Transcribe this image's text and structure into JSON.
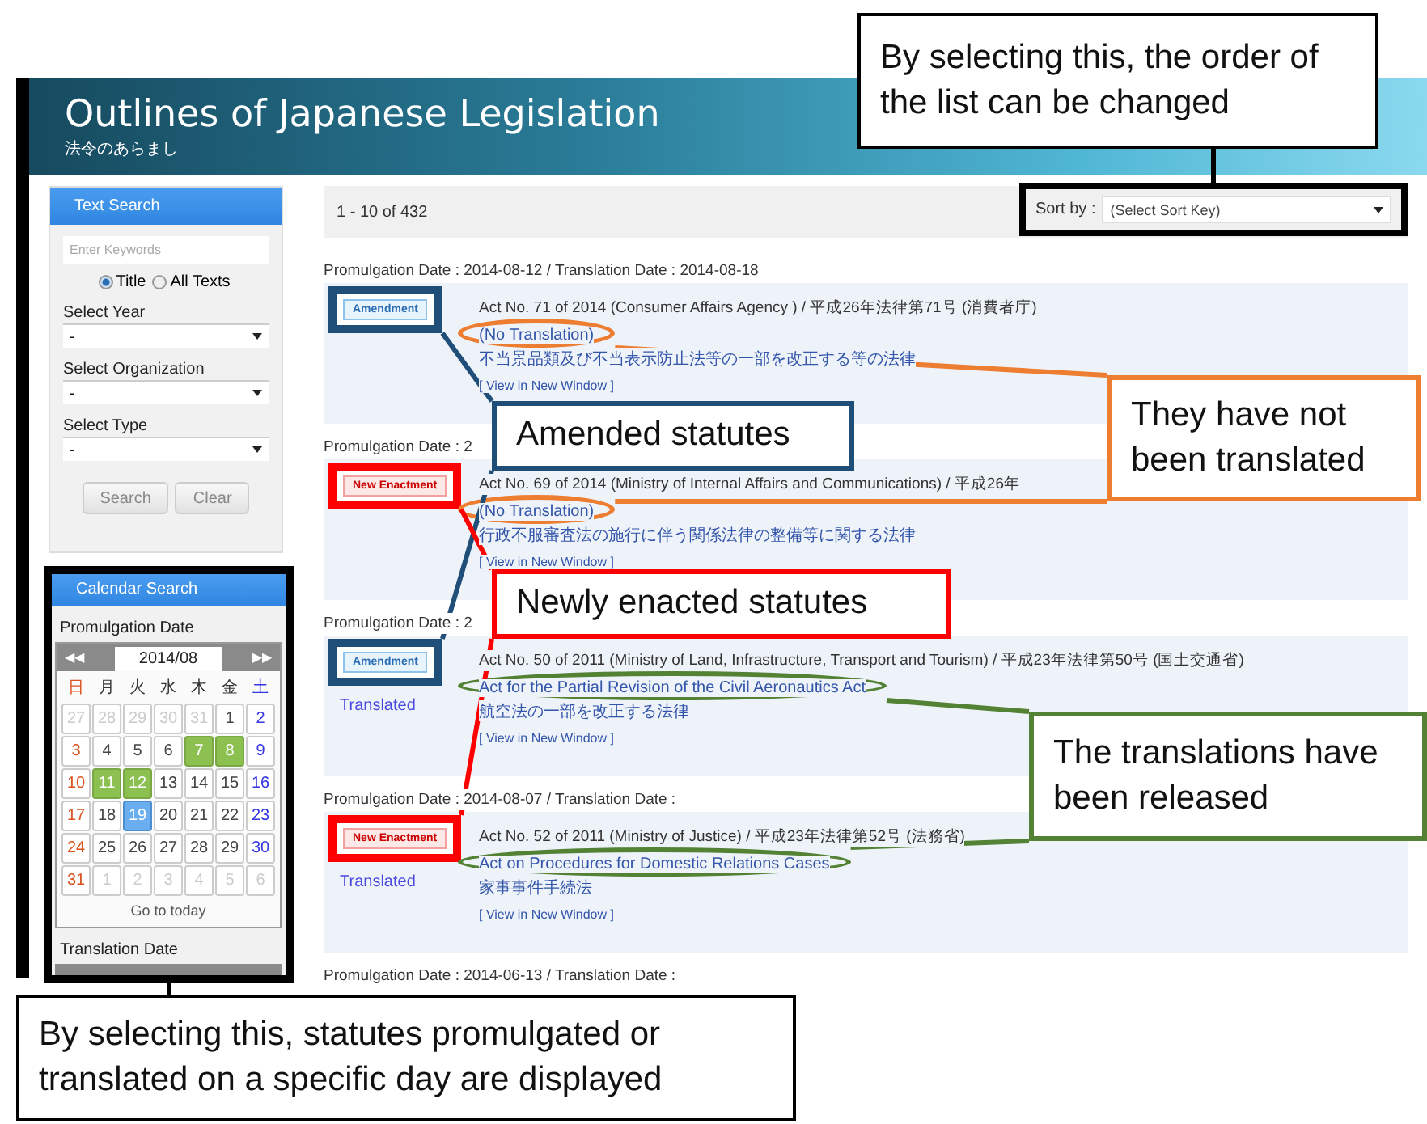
{
  "header": {
    "title": "Outlines of Japanese Legislation",
    "subtitle": "法令のあらまし"
  },
  "text_search": {
    "title": "Text Search",
    "keywords": {
      "placeholder": "Enter Keywords"
    },
    "scope": [
      {
        "label": "Title",
        "selected": true
      },
      {
        "label": "All Texts",
        "selected": false
      }
    ],
    "filters": [
      {
        "label": "Select Year",
        "value": "-"
      },
      {
        "label": "Select Organization",
        "value": "-"
      },
      {
        "label": "Select Type",
        "value": "-"
      }
    ],
    "buttons": [
      "Search",
      "Clear"
    ]
  },
  "calendar_search": {
    "title": "Calendar Search",
    "promulgation": {
      "label": "Promulgation Date",
      "prev": "◀◀",
      "next": "▶▶",
      "month": "2014/08",
      "weekdays": [
        "日",
        "月",
        "火",
        "水",
        "木",
        "金",
        "土"
      ],
      "weeks": [
        [
          {
            "day": "27",
            "other_month": true,
            "marked": false,
            "selected": false
          },
          {
            "day": "28",
            "other_month": true,
            "marked": false,
            "selected": false
          },
          {
            "day": "29",
            "other_month": true,
            "marked": false,
            "selected": false
          },
          {
            "day": "30",
            "other_month": true,
            "marked": false,
            "selected": false
          },
          {
            "day": "31",
            "other_month": true,
            "marked": false,
            "selected": false
          },
          {
            "day": "1",
            "other_month": false,
            "marked": false,
            "selected": false
          },
          {
            "day": "2",
            "other_month": false,
            "marked": false,
            "selected": false
          }
        ],
        [
          {
            "day": "3",
            "other_month": false,
            "marked": false,
            "selected": false
          },
          {
            "day": "4",
            "other_month": false,
            "marked": false,
            "selected": false
          },
          {
            "day": "5",
            "other_month": false,
            "marked": false,
            "selected": false
          },
          {
            "day": "6",
            "other_month": false,
            "marked": false,
            "selected": false
          },
          {
            "day": "7",
            "other_month": false,
            "marked": true,
            "selected": false
          },
          {
            "day": "8",
            "other_month": false,
            "marked": true,
            "selected": false
          },
          {
            "day": "9",
            "other_month": false,
            "marked": false,
            "selected": false
          }
        ],
        [
          {
            "day": "10",
            "other_month": false,
            "marked": false,
            "selected": false
          },
          {
            "day": "11",
            "other_month": false,
            "marked": true,
            "selected": false
          },
          {
            "day": "12",
            "other_month": false,
            "marked": true,
            "selected": false
          },
          {
            "day": "13",
            "other_month": false,
            "marked": false,
            "selected": false
          },
          {
            "day": "14",
            "other_month": false,
            "marked": false,
            "selected": false
          },
          {
            "day": "15",
            "other_month": false,
            "marked": false,
            "selected": false
          },
          {
            "day": "16",
            "other_month": false,
            "marked": false,
            "selected": false
          }
        ],
        [
          {
            "day": "17",
            "other_month": false,
            "marked": false,
            "selected": false
          },
          {
            "day": "18",
            "other_month": false,
            "marked": false,
            "selected": false
          },
          {
            "day": "19",
            "other_month": false,
            "marked": false,
            "selected": true
          },
          {
            "day": "20",
            "other_month": false,
            "marked": false,
            "selected": false
          },
          {
            "day": "21",
            "other_month": false,
            "marked": false,
            "selected": false
          },
          {
            "day": "22",
            "other_month": false,
            "marked": false,
            "selected": false
          },
          {
            "day": "23",
            "other_month": false,
            "marked": false,
            "selected": false
          }
        ],
        [
          {
            "day": "24",
            "other_month": false,
            "marked": false,
            "selected": false
          },
          {
            "day": "25",
            "other_month": false,
            "marked": false,
            "selected": false
          },
          {
            "day": "26",
            "other_month": false,
            "marked": false,
            "selected": false
          },
          {
            "day": "27",
            "other_month": false,
            "marked": false,
            "selected": false
          },
          {
            "day": "28",
            "other_month": false,
            "marked": false,
            "selected": false
          },
          {
            "day": "29",
            "other_month": false,
            "marked": false,
            "selected": false
          },
          {
            "day": "30",
            "other_month": false,
            "marked": false,
            "selected": false
          }
        ],
        [
          {
            "day": "31",
            "other_month": false,
            "marked": false,
            "selected": false
          },
          {
            "day": "1",
            "other_month": true,
            "marked": false,
            "selected": false
          },
          {
            "day": "2",
            "other_month": true,
            "marked": false,
            "selected": false
          },
          {
            "day": "3",
            "other_month": true,
            "marked": false,
            "selected": false
          },
          {
            "day": "4",
            "other_month": true,
            "marked": false,
            "selected": false
          },
          {
            "day": "5",
            "other_month": true,
            "marked": false,
            "selected": false
          },
          {
            "day": "6",
            "other_month": true,
            "marked": false,
            "selected": false
          }
        ]
      ],
      "today": "Go to today"
    },
    "translation": {
      "label": "Translation Date"
    }
  },
  "results": {
    "count": "1 - 10 of 432",
    "sort": {
      "label": "Sort by :",
      "value": "(Select Sort Key)"
    },
    "entries": [
      {
        "date_line": "Promulgation Date : 2014-08-12 / Translation Date : 2014-08-18",
        "badge": {
          "kind": "amendment",
          "label": "Amendment"
        },
        "act": "Act No. 71 of 2014 (Consumer Affairs Agency ) / 平成26年法律第71号 (消費者庁)",
        "title": "(No Translation)",
        "title_ja": "不当景品類及び不当表示防止法等の一部を改正する等の法律",
        "link": "[ View in New Window ]"
      },
      {
        "date_line": "Promulgation Date : 2",
        "badge": {
          "kind": "new_enactment",
          "label": "New Enactment"
        },
        "act": "Act No. 69 of 2014 (Ministry of Internal Affairs and Communications) / 平成26年",
        "title": "(No Translation)",
        "title_ja": "行政不服審査法の施行に伴う関係法律の整備等に関する法律",
        "link": "[ View in New Window ]"
      },
      {
        "date_line": "Promulgation Date : 2",
        "badge": {
          "kind": "amendment",
          "label": "Amendment"
        },
        "status": "Translated",
        "act": "Act No. 50 of 2011 (Ministry of Land, Infrastructure, Transport and Tourism) / 平成23年法律第50号 (国土交通省)",
        "title": "Act for the Partial Revision of the Civil Aeronautics Act",
        "title_ja": "航空法の一部を改正する法律",
        "link": "[ View in New Window ]"
      },
      {
        "date_line": "Promulgation Date : 2014-08-07 / Translation Date :",
        "badge": {
          "kind": "new_enactment",
          "label": "New Enactment"
        },
        "status": "Translated",
        "act": "Act No. 52 of 2011 (Ministry of Justice) / 平成23年法律第52号 (法務省)",
        "title": "Act on Procedures for Domestic Relations Cases",
        "title_ja": "家事事件手続法",
        "link": "[ View in New Window ]"
      },
      {
        "date_line": "Promulgation Date : 2014-06-13 / Translation Date :"
      }
    ]
  },
  "annotations": [
    {
      "kind": "sort",
      "text": "By selecting this, the order of the list can be changed",
      "color": "#000000"
    },
    {
      "kind": "amendment",
      "text": "Amended statutes",
      "color": "#1f4e79"
    },
    {
      "kind": "untranslated",
      "text": "They have not been translated",
      "color": "#ed7d31"
    },
    {
      "kind": "new_enactment",
      "text": "Newly enacted statutes",
      "color": "#ff0000"
    },
    {
      "kind": "translated",
      "text": "The translations have been released",
      "color": "#548235"
    },
    {
      "kind": "calendar",
      "text": "By selecting this, statutes promulgated or translated on a specific day are displayed",
      "color": "#000000"
    }
  ]
}
